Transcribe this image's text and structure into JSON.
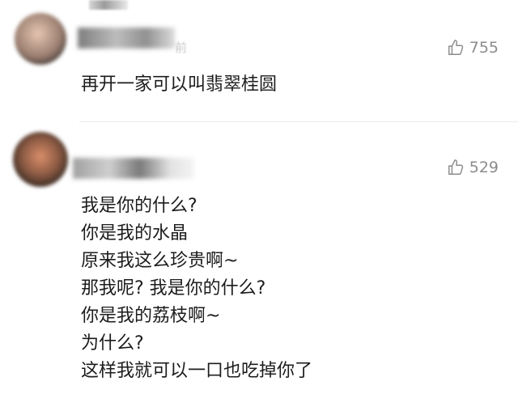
{
  "comments": [
    {
      "likes": "755",
      "time": "前",
      "lines": [
        "再开一家可以叫翡翠桂圆"
      ]
    },
    {
      "likes": "529",
      "lines": [
        "我是你的什么?",
        "你是我的水晶",
        "原来我这么珍贵啊~",
        "那我呢? 我是你的什么?",
        "你是我的荔枝啊~",
        "为什么?",
        "这样我就可以一口也吃掉你了"
      ]
    }
  ],
  "icons": {
    "like": "thumbs-up-icon"
  },
  "colors": {
    "like_text": "#8c8c8c",
    "body_text": "#1c1c1c",
    "divider": "#ececec"
  }
}
